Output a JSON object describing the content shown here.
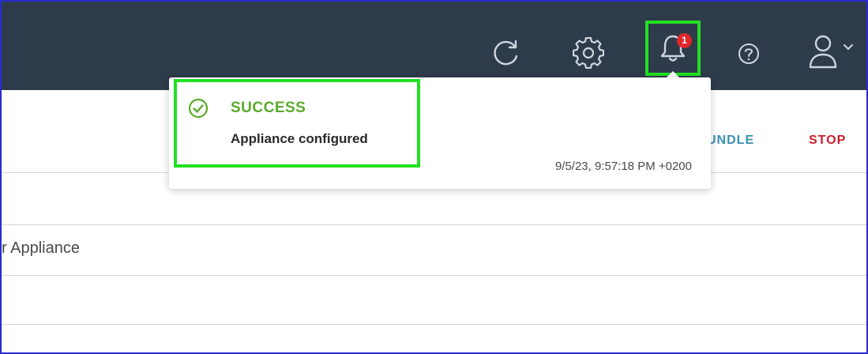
{
  "header": {
    "icons": {
      "refresh": "refresh-icon",
      "settings": "gear-icon",
      "notifications": "bell-icon",
      "help": "help-icon",
      "user": "user-icon",
      "user_menu": "chevron-down-icon"
    },
    "notification_count": "1",
    "background_color": "#2e3b4b",
    "badge_color": "#e0272a"
  },
  "toolbar": {
    "actions": [
      {
        "label": "UNDLE",
        "color": "#3a8fb0"
      },
      {
        "label": "STOP",
        "color": "#c8202a"
      }
    ]
  },
  "rows": [
    "",
    "r Appliance",
    "",
    ""
  ],
  "notification": {
    "status": "SUCCESS",
    "message": "Appliance configured",
    "timestamp": "9/5/23, 9:57:18 PM +0200",
    "status_color": "#5aaa2a",
    "highlight_color": "#22e022"
  }
}
